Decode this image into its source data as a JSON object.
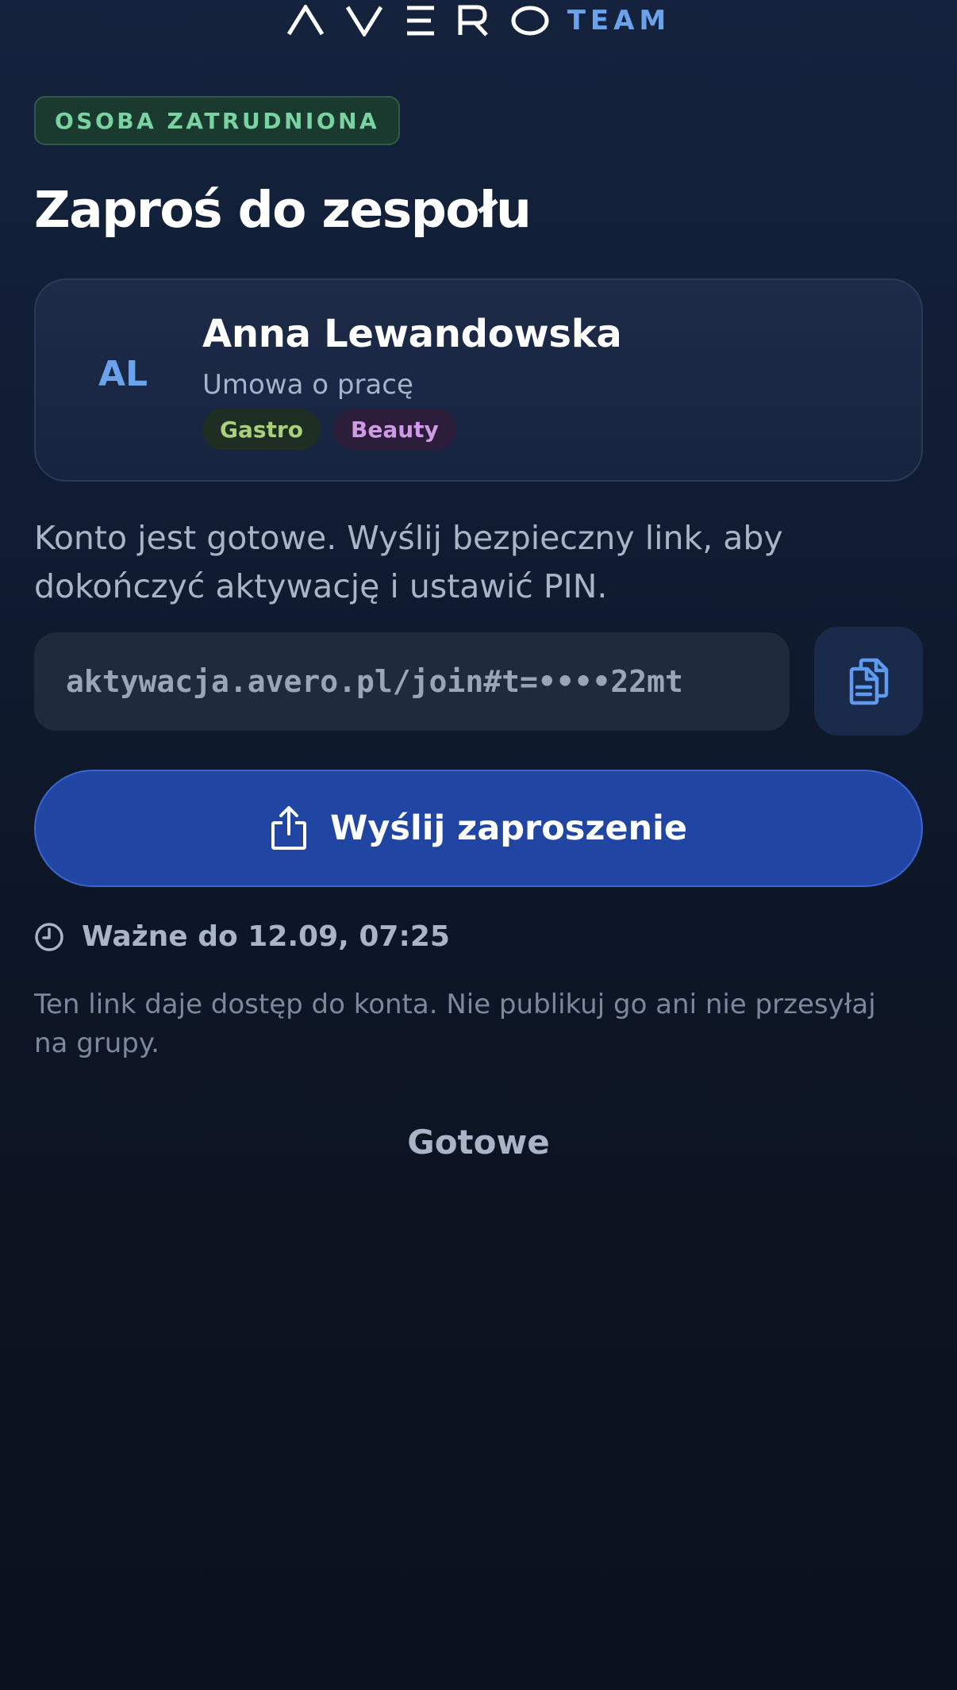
{
  "brand": {
    "name": "AVERO",
    "suffix": "TEAM"
  },
  "role_badge": "OSOBA ZATRUDNIONA",
  "title": "Zaproś do zespołu",
  "person": {
    "initials": "AL",
    "name": "Anna Lewandowska",
    "contract": "Umowa o pracę",
    "tags": [
      {
        "label": "Gastro"
      },
      {
        "label": "Beauty"
      }
    ]
  },
  "info_text": "Konto jest gotowe. Wyślij bezpieczny link, aby dokończyć aktywację i ustawić PIN.",
  "link": {
    "value": "aktywacja.avero.pl/join#t=••••22mt"
  },
  "send_button": {
    "label": "Wyślij zaproszenie",
    "icon": "share-icon"
  },
  "expiry": {
    "text": "Ważne do 12.09, 07:25",
    "icon": "clock-icon"
  },
  "warning": "Ten link daje dostęp do konta. Nie publikuj go ani nie przesyłaj na grupy.",
  "done_label": "Gotowe",
  "colors": {
    "accent": "#2145a3",
    "brand_team": "#6aa3ec",
    "badge_green": "#79d3a0",
    "tag_gastro": "#a9d07a",
    "tag_beauty": "#d09be6"
  }
}
